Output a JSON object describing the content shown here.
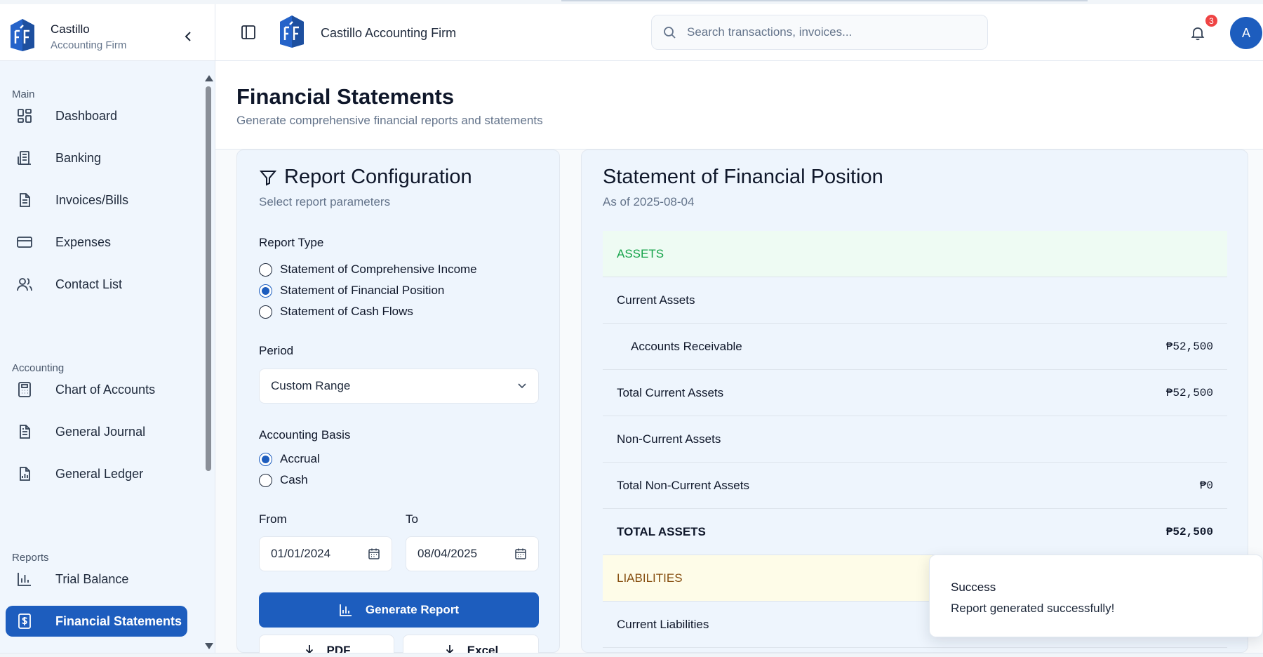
{
  "brand": {
    "name": "Castillo",
    "subtitle": "Accounting Firm",
    "title": "Castillo Accounting Firm"
  },
  "search": {
    "placeholder": "Search transactions, invoices..."
  },
  "notifications": {
    "count": "3"
  },
  "user": {
    "initial": "A"
  },
  "sidebar": {
    "sections": {
      "main": "Main",
      "accounting": "Accounting",
      "reports": "Reports"
    },
    "main_items": [
      {
        "label": "Dashboard",
        "icon": "dashboard-icon"
      },
      {
        "label": "Banking",
        "icon": "bank-icon"
      },
      {
        "label": "Invoices/Bills",
        "icon": "document-icon"
      },
      {
        "label": "Expenses",
        "icon": "credit-card-icon"
      },
      {
        "label": "Contact List",
        "icon": "users-icon"
      }
    ],
    "accounting_items": [
      {
        "label": "Chart of Accounts",
        "icon": "calculator-icon"
      },
      {
        "label": "General Journal",
        "icon": "journal-icon"
      },
      {
        "label": "General Ledger",
        "icon": "ledger-icon"
      }
    ],
    "reports_items": [
      {
        "label": "Trial Balance",
        "icon": "bar-chart-icon"
      },
      {
        "label": "Financial Statements",
        "icon": "dollar-document-icon",
        "active": true
      }
    ]
  },
  "page": {
    "title": "Financial Statements",
    "subtitle": "Generate comprehensive financial reports and statements"
  },
  "config": {
    "title": "Report Configuration",
    "subtitle": "Select report parameters",
    "report_type_label": "Report Type",
    "report_types": [
      {
        "label": "Statement of Comprehensive Income",
        "selected": false
      },
      {
        "label": "Statement of Financial Position",
        "selected": true
      },
      {
        "label": "Statement of Cash Flows",
        "selected": false
      }
    ],
    "period_label": "Period",
    "period_value": "Custom Range",
    "basis_label": "Accounting Basis",
    "basis_options": [
      {
        "label": "Accrual",
        "selected": true
      },
      {
        "label": "Cash",
        "selected": false
      }
    ],
    "from_label": "From",
    "from_value": "01/01/2024",
    "to_label": "To",
    "to_value": "08/04/2025",
    "generate_label": "Generate Report",
    "pdf_label": "PDF",
    "excel_label": "Excel"
  },
  "statement": {
    "title": "Statement of Financial Position",
    "subtitle": "As of 2025-08-04",
    "rows": [
      {
        "name": "ASSETS",
        "amount": "",
        "kind": "hdr-assets"
      },
      {
        "name": "Current Assets",
        "amount": "",
        "kind": "group"
      },
      {
        "name": "Accounts Receivable",
        "amount": "₱52,500",
        "kind": "sub"
      },
      {
        "name": "Total Current Assets",
        "amount": "₱52,500",
        "kind": "total"
      },
      {
        "name": "Non-Current Assets",
        "amount": "",
        "kind": "group"
      },
      {
        "name": "Total Non-Current Assets",
        "amount": "₱0",
        "kind": "total"
      },
      {
        "name": "TOTAL ASSETS",
        "amount": "₱52,500",
        "kind": "bold"
      },
      {
        "name": "LIABILITIES",
        "amount": "",
        "kind": "hdr-liab"
      },
      {
        "name": "Current Liabilities",
        "amount": "",
        "kind": "group"
      }
    ]
  },
  "toast": {
    "title": "Success",
    "message": "Report generated successfully!"
  },
  "colors": {
    "primary": "#1d5dbe",
    "assets": "#16a34a",
    "liabilities": "#854d0e",
    "badge": "#ef4444"
  }
}
